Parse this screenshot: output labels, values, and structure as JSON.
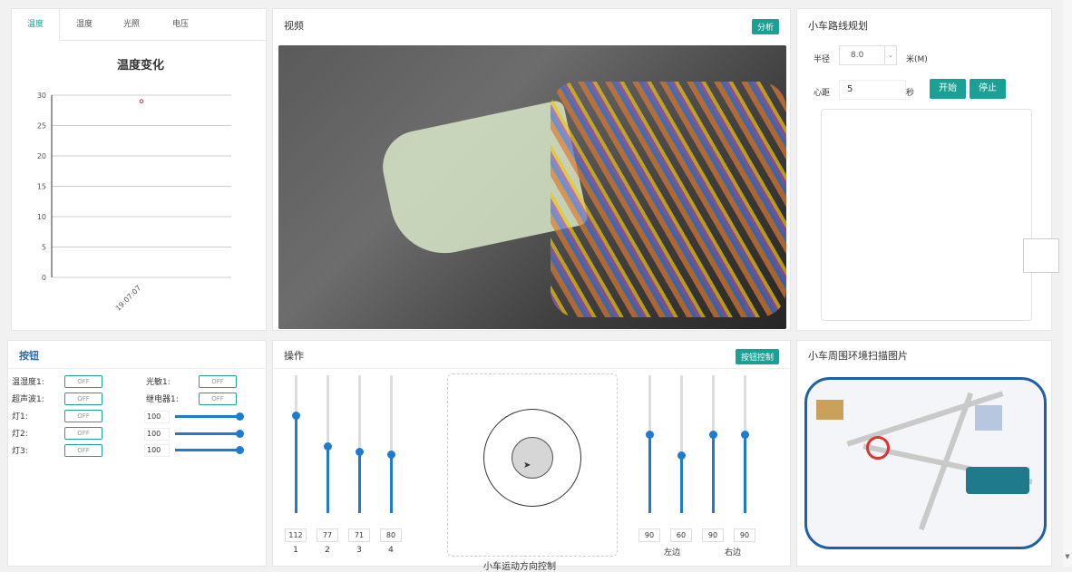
{
  "chart_panel": {
    "tabs": [
      "温度",
      "湿度",
      "光照",
      "电压"
    ],
    "active_tab": 0
  },
  "chart_data": {
    "type": "scatter",
    "title": "温度变化",
    "x": [
      "19:07:07"
    ],
    "y": [
      29
    ],
    "ylim": [
      0,
      30
    ],
    "yticks": [
      0,
      5,
      10,
      15,
      20,
      25,
      30
    ],
    "xlabel": "",
    "ylabel": "",
    "grid": true,
    "marker_color": "#c23531"
  },
  "video": {
    "title": "视频",
    "capture_button": "分析"
  },
  "route": {
    "title": "小车路线规划",
    "radius_label": "半径",
    "radius_value": "8.0",
    "radius_unit": "米(M)",
    "speed_label": "心距",
    "speed_value": "5",
    "speed_unit": "秒",
    "start_button": "开始",
    "stop_button": "停止"
  },
  "buttons_panel": {
    "title": "按钮",
    "left_items": [
      {
        "label": "温湿度1:",
        "state": "OFF"
      },
      {
        "label": "超声波1:",
        "state": "OFF"
      },
      {
        "label": "灯1:",
        "state": "OFF"
      },
      {
        "label": "灯2:",
        "state": "OFF"
      },
      {
        "label": "灯3:",
        "state": "OFF"
      }
    ],
    "right_items": [
      {
        "label": "光敏1:",
        "state": "OFF"
      },
      {
        "label": "继电器1:",
        "state": "OFF"
      }
    ],
    "slider_values": [
      "100",
      "100",
      "100"
    ]
  },
  "ops_panel": {
    "title": "操作",
    "button": "按钮控制",
    "left_sliders": [
      {
        "value": "112",
        "label": "1",
        "level": 0.71
      },
      {
        "value": "77",
        "label": "2",
        "level": 0.49
      },
      {
        "value": "71",
        "label": "3",
        "level": 0.45
      },
      {
        "value": "80",
        "label": "4",
        "level": 0.43
      }
    ],
    "right_sliders": [
      {
        "value": "90",
        "level": 0.57
      },
      {
        "value": "60",
        "level": 0.42
      },
      {
        "value": "90",
        "level": 0.57
      },
      {
        "value": "90",
        "level": 0.57
      }
    ],
    "left_group_label": "左边",
    "right_group_label": "右边",
    "joystick_caption": "小车运动方向控制"
  },
  "scan_panel": {
    "title": "小车周围环境扫描图片"
  },
  "colors": {
    "accent": "#1aa094",
    "slider": "#1e7bd0",
    "title_blue": "#2b6cb0"
  }
}
